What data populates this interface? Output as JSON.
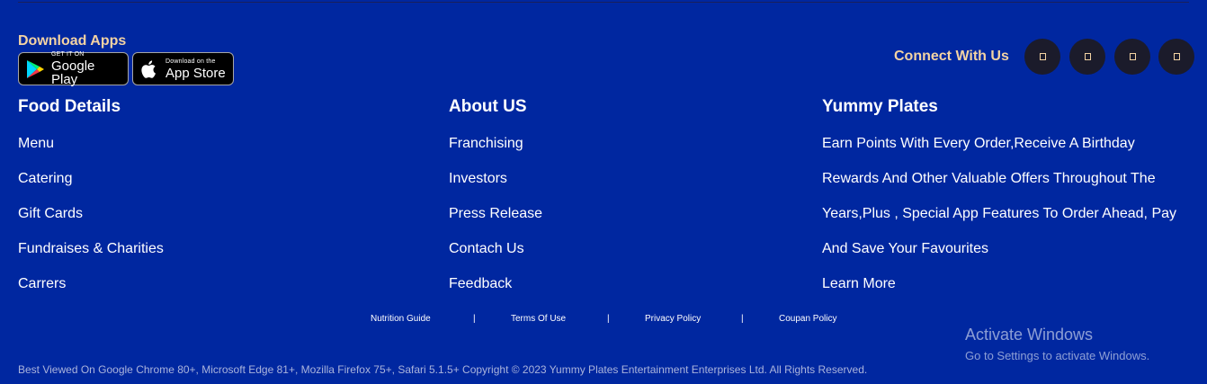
{
  "apps": {
    "title": "Download Apps",
    "google_play": {
      "small": "GET IT ON",
      "big": "Google Play"
    },
    "app_store": {
      "small": "Download on the",
      "big": "App Store"
    }
  },
  "connect": {
    "label": "Connect With Us",
    "icons": [
      "facebook-icon",
      "twitter-icon",
      "instagram-icon",
      "youtube-icon"
    ]
  },
  "food_details": {
    "title": "Food Details",
    "links": [
      "Menu",
      "Catering",
      "Gift Cards",
      "Fundraises & Charities",
      "Carrers"
    ]
  },
  "about_us": {
    "title": "About US",
    "links": [
      "Franchising",
      "Investors",
      "Press Release",
      "Contach Us",
      "Feedback"
    ]
  },
  "yummy_plates": {
    "title": "Yummy Plates",
    "lines": [
      "Earn Points With Every Order,Receive A Birthday",
      "Rewards And Other Valuable Offers Throughout The",
      "Years,Plus , Special App Features To Order Ahead, Pay",
      "And Save Your Favourites"
    ],
    "learn_more": "Learn More"
  },
  "policies": {
    "items": [
      "Nutrition Guide",
      "Terms Of Use",
      "Privacy Policy",
      "Coupan Policy"
    ],
    "separator": "|"
  },
  "copyright": "Best Viewed On Google Chrome 80+, Microsoft Edge 81+, Mozilla Firefox 75+, Safari 5.1.5+ Copyright © 2023 Yummy Plates Entertainment Enterprises Ltd. All Rights Reserved.",
  "windows_watermark": {
    "title": "Activate Windows",
    "subtitle": "Go to Settings to activate Windows."
  },
  "colors": {
    "background": "#0027a0",
    "accent": "#f3d3a3",
    "social_bg": "#1b1b2b"
  }
}
